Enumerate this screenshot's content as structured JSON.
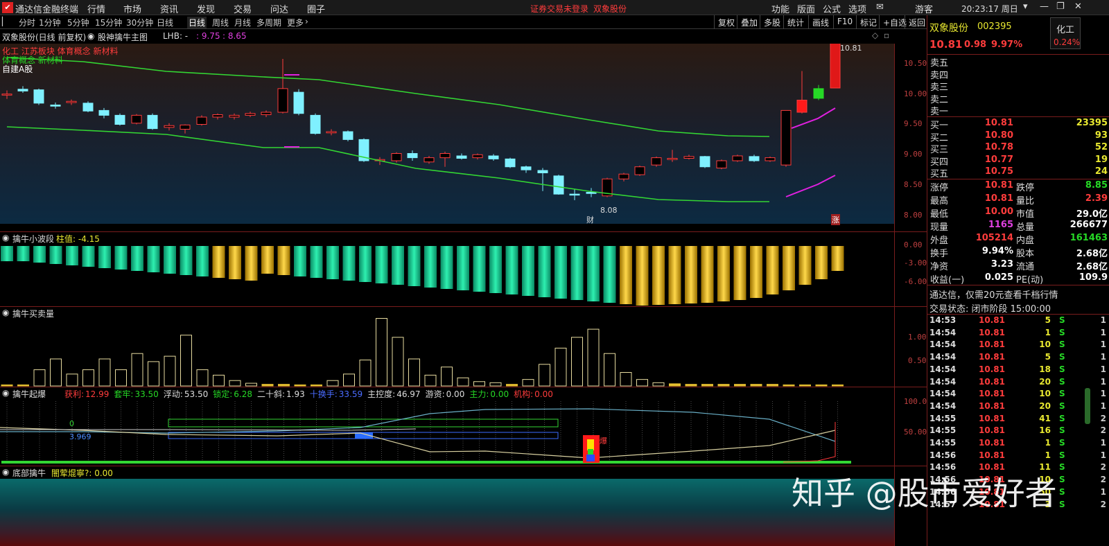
{
  "menubar": {
    "app_title": "通达信金融终端",
    "items": [
      "行情",
      "市场",
      "资讯",
      "发现",
      "交易",
      "问达",
      "圈子"
    ],
    "notice": "证券交易未登录",
    "stock_link": "双象股份",
    "right_items": [
      "功能",
      "版面",
      "公式",
      "选项"
    ],
    "user": "游客",
    "clock": "20:23:17 周日"
  },
  "toolbar": {
    "periods": [
      "分时",
      "1分钟",
      "5分钟",
      "15分钟",
      "30分钟",
      "日线",
      "周线",
      "月线",
      "多周期",
      "更多"
    ],
    "active_period": "日线",
    "right": [
      "复权",
      "叠加",
      "多股",
      "统计",
      "画线",
      "F10",
      "标记",
      "+自选",
      "返回"
    ]
  },
  "main_chart": {
    "title": "双象股份(日线 前复权)",
    "indicator": "股神擒牛主图",
    "lhb_label": "LHB: -",
    "lhb_v1": ": 9.75",
    "lhb_v2": ": 8.65",
    "tag_line1": "化工 江苏板块 体育概念 新材料",
    "tag_line2": "体育概念 新材料",
    "tag_line3": "自建A股",
    "y_ticks": [
      "10.50",
      "10.00",
      "9.50",
      "9.00",
      "8.50",
      "8.00"
    ],
    "high_label": "10.81",
    "low_label": "8.08",
    "marker_cai": "财",
    "marker_zhang": "涨"
  },
  "pane2": {
    "title": "擒牛小波段",
    "value_label": "柱值: -4.15",
    "y_ticks": [
      "0.00",
      "-3.00",
      "-6.00"
    ]
  },
  "pane3": {
    "title": "擒牛买卖量",
    "y_ticks": [
      "1.00",
      "0.50"
    ]
  },
  "pane4": {
    "title": "擒牛起爆",
    "stats": [
      {
        "k": "获利:",
        "v": "12.99",
        "c": "#ff3c3c"
      },
      {
        "k": "套牢:",
        "v": "33.50",
        "c": "#26d926"
      },
      {
        "k": "浮动:",
        "v": "53.50",
        "c": "#ddd"
      },
      {
        "k": "锁定:",
        "v": "6.28",
        "c": "#26d926"
      },
      {
        "k": "二十斜:",
        "v": "1.93",
        "c": "#ddd"
      },
      {
        "k": "十换手:",
        "v": "33.59",
        "c": "#4a6cff"
      },
      {
        "k": "主控度:",
        "v": "46.97",
        "c": "#ddd"
      },
      {
        "k": "游资:",
        "v": "0.00",
        "c": "#ddd"
      },
      {
        "k": "主力:",
        "v": "0.00",
        "c": "#26d926"
      },
      {
        "k": "机构:",
        "v": "0.00",
        "c": "#ff3c3c"
      }
    ],
    "y_ticks": [
      "100.0",
      "50.00"
    ],
    "box_green_label": "0",
    "box_blue_label": "3.969",
    "badge": "爆"
  },
  "pane5": {
    "title": "底部擒牛",
    "sub": "闇荤焜寧?: 0.00"
  },
  "quote": {
    "name": "双象股份",
    "code": "002395",
    "sector": "化工",
    "price": "10.81",
    "change": "0.98",
    "pct": "9.97%",
    "sector_pct": "0.24%",
    "sells": [
      "卖五",
      "卖四",
      "卖三",
      "卖二",
      "卖一"
    ],
    "buys": [
      {
        "label": "买一",
        "price": "10.81",
        "vol": "23395"
      },
      {
        "label": "买二",
        "price": "10.80",
        "vol": "93"
      },
      {
        "label": "买三",
        "price": "10.78",
        "vol": "52"
      },
      {
        "label": "买四",
        "price": "10.77",
        "vol": "19"
      },
      {
        "label": "买五",
        "price": "10.75",
        "vol": "24"
      }
    ],
    "stats": [
      {
        "l1": "涨停",
        "v1": "10.81",
        "c1": "#ff3c3c",
        "l2": "跌停",
        "v2": "8.85",
        "c2": "#26d926"
      },
      {
        "l1": "最高",
        "v1": "10.81",
        "c1": "#ff3c3c",
        "l2": "量比",
        "v2": "2.39",
        "c2": "#ff3c3c"
      },
      {
        "l1": "最低",
        "v1": "10.00",
        "c1": "#ff3c3c",
        "l2": "市值",
        "v2": "29.0亿",
        "c2": "#fff"
      },
      {
        "l1": "现量",
        "v1": "1165",
        "c1": "#e040e0",
        "l2": "总量",
        "v2": "266677",
        "c2": "#fff"
      },
      {
        "l1": "外盘",
        "v1": "105214",
        "c1": "#ff3c3c",
        "l2": "内盘",
        "v2": "161463",
        "c2": "#26d926"
      },
      {
        "l1": "换手",
        "v1": "9.94%",
        "c1": "#fff",
        "l2": "股本",
        "v2": "2.68亿",
        "c2": "#fff"
      },
      {
        "l1": "净资",
        "v1": "3.23",
        "c1": "#fff",
        "l2": "流通",
        "v2": "2.68亿",
        "c2": "#fff"
      },
      {
        "l1": "收益(一)",
        "v1": "0.025",
        "c1": "#fff",
        "l2": "PE(动)",
        "v2": "109.9",
        "c2": "#fff"
      }
    ],
    "promo": "通达信，仅需20元查看千档行情",
    "trade_state": "交易状态: 闭市阶段 15:00:00",
    "ticks": [
      {
        "t": "14:53",
        "p": "10.81",
        "v": "5",
        "bs": "S",
        "n": "1"
      },
      {
        "t": "14:54",
        "p": "10.81",
        "v": "1",
        "bs": "S",
        "n": "1"
      },
      {
        "t": "14:54",
        "p": "10.81",
        "v": "10",
        "bs": "S",
        "n": "1"
      },
      {
        "t": "14:54",
        "p": "10.81",
        "v": "5",
        "bs": "S",
        "n": "1"
      },
      {
        "t": "14:54",
        "p": "10.81",
        "v": "18",
        "bs": "S",
        "n": "1"
      },
      {
        "t": "14:54",
        "p": "10.81",
        "v": "20",
        "bs": "S",
        "n": "1"
      },
      {
        "t": "14:54",
        "p": "10.81",
        "v": "10",
        "bs": "S",
        "n": "1"
      },
      {
        "t": "14:54",
        "p": "10.81",
        "v": "20",
        "bs": "S",
        "n": "1"
      },
      {
        "t": "14:55",
        "p": "10.81",
        "v": "41",
        "bs": "S",
        "n": "2"
      },
      {
        "t": "14:55",
        "p": "10.81",
        "v": "16",
        "bs": "S",
        "n": "2"
      },
      {
        "t": "14:55",
        "p": "10.81",
        "v": "1",
        "bs": "S",
        "n": "1"
      },
      {
        "t": "14:56",
        "p": "10.81",
        "v": "1",
        "bs": "S",
        "n": "1"
      },
      {
        "t": "14:56",
        "p": "10.81",
        "v": "11",
        "bs": "S",
        "n": "2"
      },
      {
        "t": "14:56",
        "p": "10.81",
        "v": "10",
        "bs": "S",
        "n": "2"
      },
      {
        "t": "14:56",
        "p": "10.81",
        "v": "50",
        "bs": "S",
        "n": "1"
      },
      {
        "t": "14:57",
        "p": "10.81",
        "v": "3",
        "bs": "S",
        "n": "2"
      }
    ]
  },
  "watermark": "知乎 @股市爱好者"
}
